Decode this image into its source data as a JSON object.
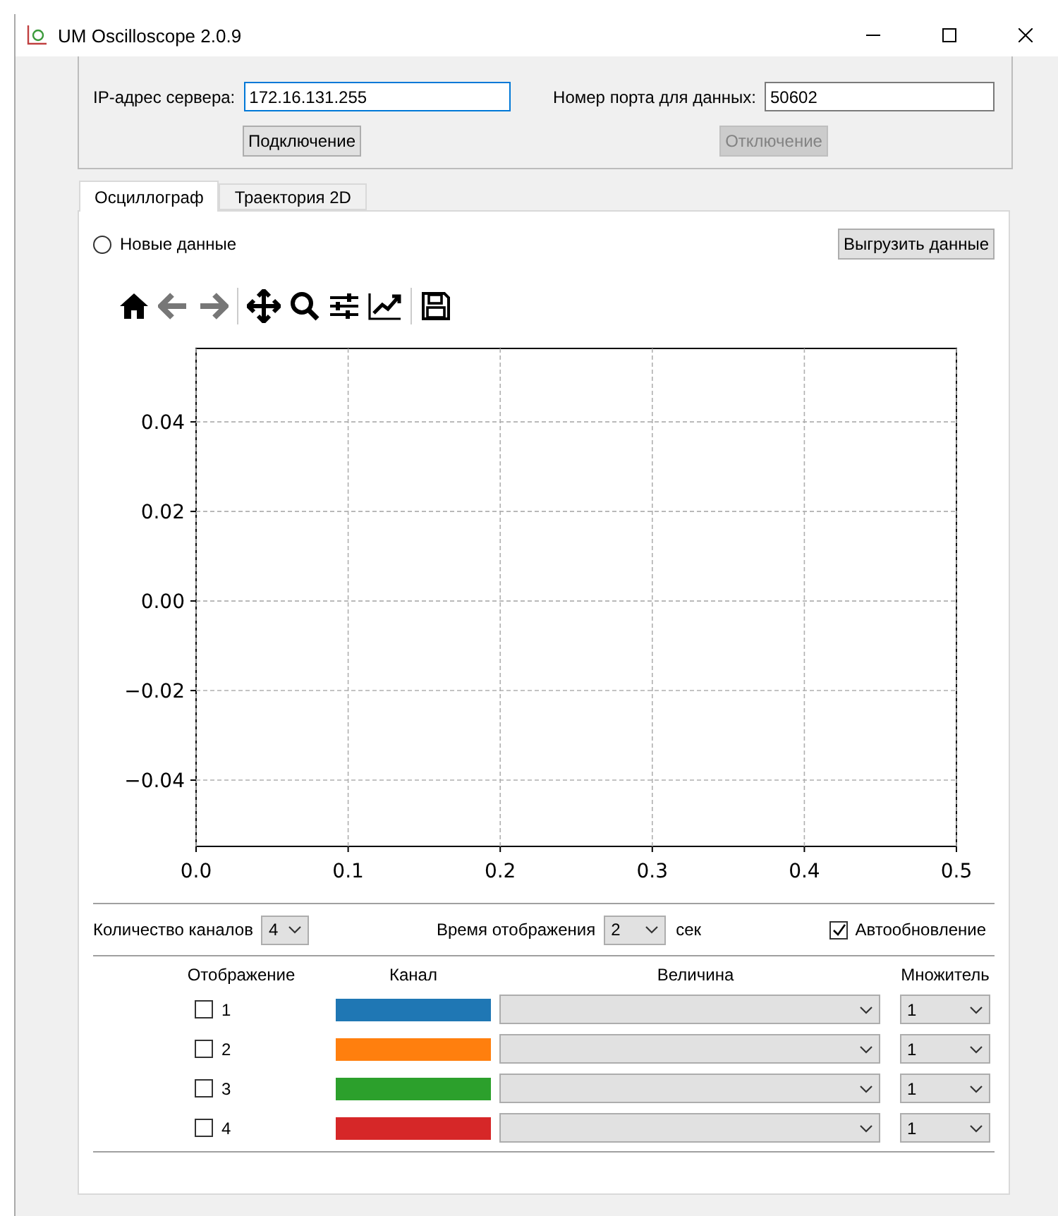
{
  "window": {
    "title": "UM Oscilloscope 2.0.9"
  },
  "server": {
    "ip_label": "IP-адрес сервера:",
    "ip_value": "172.16.131.255",
    "ip_focused": true,
    "port_label": "Номер порта для данных:",
    "port_value": "50602",
    "connect_button": {
      "label": "Подключение",
      "disabled": false
    },
    "disconnect_button": {
      "label": "Отключение",
      "disabled": true
    }
  },
  "tabs": [
    {
      "label": "Осциллограф",
      "selected": true
    },
    {
      "label": "Траектория 2D",
      "selected": false
    }
  ],
  "new_data": {
    "label": "Новые данные",
    "selected": false
  },
  "export_button": "Выгрузить данные",
  "chart_data": {
    "type": "line",
    "grid": true,
    "xlim": [
      0,
      0.5
    ],
    "ylim": [
      -0.0548,
      0.0564
    ],
    "xticks": [
      {
        "value": 0,
        "label": "0.0"
      },
      {
        "value": 0.1,
        "label": "0.1"
      },
      {
        "value": 0.2,
        "label": "0.2"
      },
      {
        "value": 0.3,
        "label": "0.3"
      },
      {
        "value": 0.4,
        "label": "0.4"
      },
      {
        "value": 0.5,
        "label": "0.5"
      }
    ],
    "yticks": [
      {
        "value": 0.04,
        "label": "0.04"
      },
      {
        "value": 0.02,
        "label": "0.02"
      },
      {
        "value": 0,
        "label": "0.00"
      },
      {
        "value": -0.02,
        "label": "−0.02"
      },
      {
        "value": -0.04,
        "label": "−0.04"
      }
    ]
  },
  "controls": {
    "channels_label": "Количество каналов",
    "channels_value": "4",
    "time_label": "Время отображения",
    "time_value": "2",
    "time_unit": "сек",
    "autoupdate": {
      "label": "Автообновление",
      "checked": true
    }
  },
  "channel_table": {
    "columns": [
      "Отображение",
      "Канал",
      "Величина",
      "Множитель"
    ],
    "rows": [
      {
        "number": "1",
        "checked": false,
        "color": "#1f77b4",
        "multiplier": "1"
      },
      {
        "number": "2",
        "checked": false,
        "color": "#ff7f0e",
        "multiplier": "1"
      },
      {
        "number": "3",
        "checked": false,
        "color": "#2ca02c",
        "multiplier": "1"
      },
      {
        "number": "4",
        "checked": false,
        "color": "#d62728",
        "multiplier": "1"
      }
    ]
  }
}
